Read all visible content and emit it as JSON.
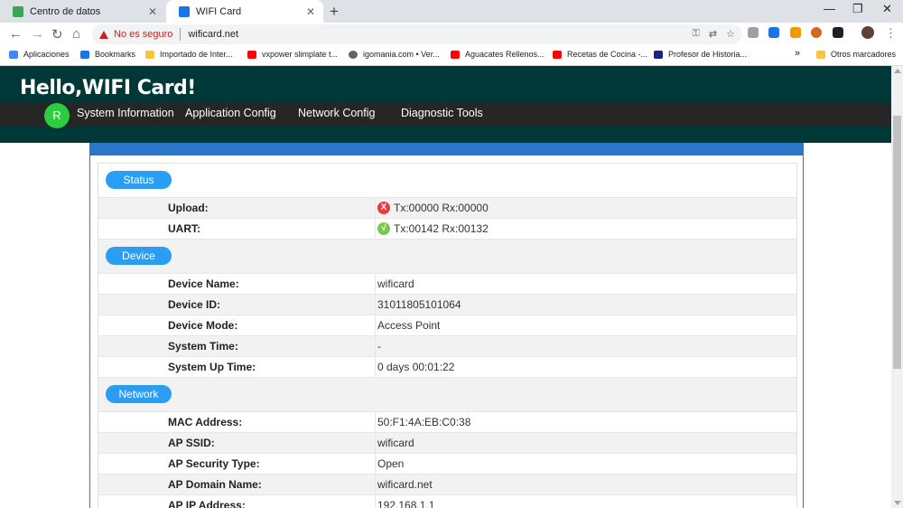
{
  "browser": {
    "tabs": [
      {
        "title": "Centro de datos",
        "close": "✕"
      },
      {
        "title": "WIFI Card",
        "close": "✕"
      }
    ],
    "new_tab": "+",
    "window_controls": {
      "minimize": "—",
      "maximize": "❐",
      "close": "✕"
    },
    "nav": {
      "back": "←",
      "forward": "→",
      "reload": "↻",
      "home": "⌂"
    },
    "security_label": "No es seguro",
    "url": "wificard.net",
    "bookmarks": [
      {
        "label": "Aplicaciones",
        "color": "#4285f4"
      },
      {
        "label": "Bookmarks",
        "color": "#1a73e8"
      },
      {
        "label": "Importado de Inter...",
        "color": "#f4c542"
      },
      {
        "label": "vxpower slimplate t...",
        "color": "#ff0000"
      },
      {
        "label": "igomania.com • Ver...",
        "color": "#5f6368"
      },
      {
        "label": "Aguacates Rellenos...",
        "color": "#ff0000"
      },
      {
        "label": "Recetas de Cocina -...",
        "color": "#ff0000"
      },
      {
        "label": "Profesor de Historia...",
        "color": "#1a237e"
      }
    ],
    "bookmarks_overflow": "»",
    "other_bookmarks": "Otros marcadores"
  },
  "app": {
    "brand": "Hello,WIFI Card!",
    "avatar_letter": "R",
    "menu": [
      "System Information",
      "Application Config",
      "Network Config",
      "Diagnostic Tools"
    ]
  },
  "status": {
    "title": "Status",
    "upload": {
      "label": "Upload:",
      "icon": "X",
      "value": "Tx:00000 Rx:00000"
    },
    "uart": {
      "label": "UART:",
      "icon": "√",
      "value": "Tx:00142 Rx:00132"
    }
  },
  "device": {
    "title": "Device",
    "rows": [
      {
        "label": "Device Name:",
        "value": "wificard"
      },
      {
        "label": "Device ID:",
        "value": "31011805101064"
      },
      {
        "label": "Device Mode:",
        "value": "Access Point"
      },
      {
        "label": "System Time:",
        "value": "-"
      },
      {
        "label": "System Up Time:",
        "value": "0 days 00:01:22"
      }
    ]
  },
  "network": {
    "title": "Network",
    "rows": [
      {
        "label": "MAC Address:",
        "value": "50:F1:4A:EB:C0:38"
      },
      {
        "label": "AP SSID:",
        "value": "wificard"
      },
      {
        "label": "AP Security Type:",
        "value": "Open"
      },
      {
        "label": "AP Domain Name:",
        "value": "wificard.net"
      },
      {
        "label": "AP IP Address:",
        "value": "192.168.1.1"
      }
    ]
  },
  "colors": {
    "header": "#003838",
    "menubar": "#262626",
    "accent": "#2a9df4",
    "error": "#e83b3b",
    "ok": "#7bc94a"
  }
}
